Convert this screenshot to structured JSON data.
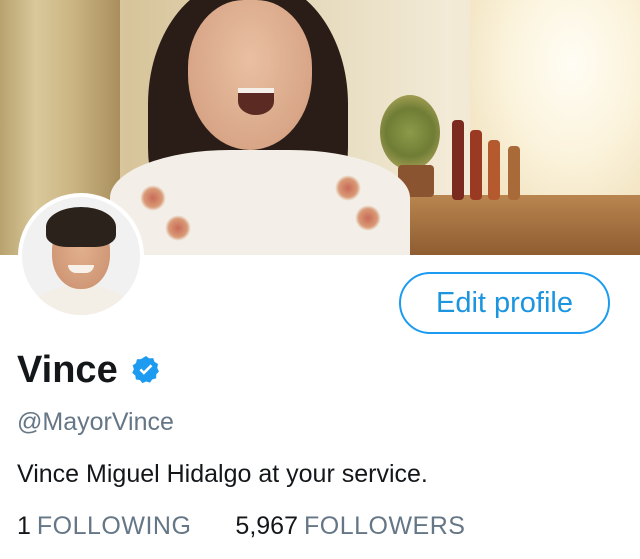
{
  "profile": {
    "display_name": "Vince",
    "handle": "@MayorVince",
    "bio": "Vince Miguel Hidalgo at your service.",
    "verified": true
  },
  "actions": {
    "edit_profile_label": "Edit profile"
  },
  "stats": {
    "following_count": "1",
    "following_label": "FOLLOWING",
    "followers_count": "5,967",
    "followers_label": "FOLLOWERS"
  },
  "colors": {
    "accent": "#1b95e0",
    "name_text": "#14171a",
    "secondary_text": "#657786",
    "verified_badge": "#1d9bf0"
  },
  "icons": {
    "verified": "verified-badge-icon"
  }
}
